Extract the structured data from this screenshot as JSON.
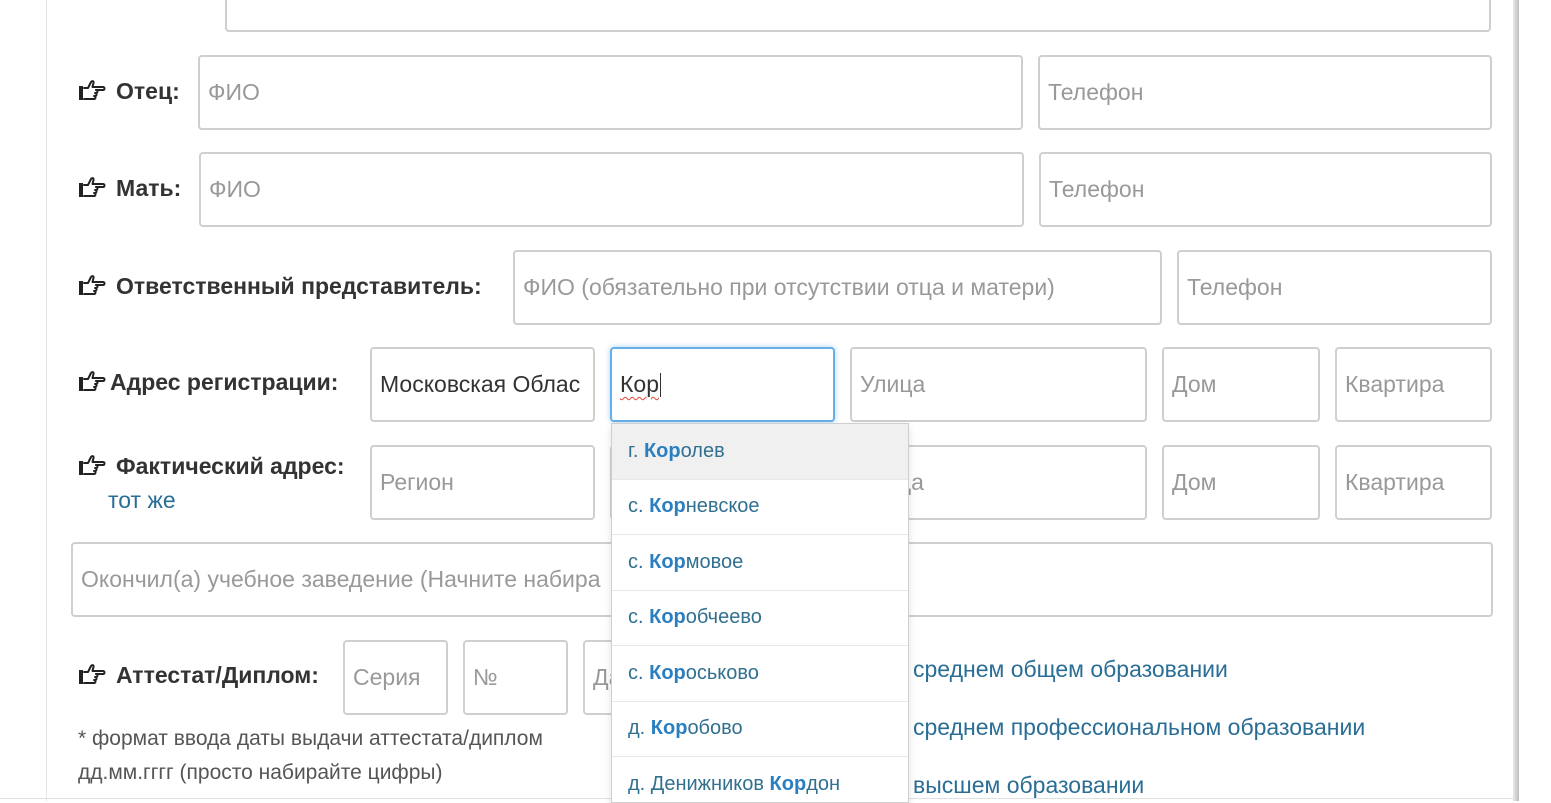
{
  "father": {
    "label": "Отец:",
    "fio_placeholder": "ФИО",
    "phone_placeholder": "Телефон"
  },
  "mother": {
    "label": "Мать:",
    "fio_placeholder": "ФИО",
    "phone_placeholder": "Телефон"
  },
  "guardian": {
    "label": "Ответственный представитель:",
    "fio_placeholder": "ФИО (обязательно при отсутствии отца и матери)",
    "phone_placeholder": "Телефон"
  },
  "reg_address": {
    "label": "Адрес регистрации:",
    "region_value": "Московская Облас",
    "city_value": "Кор",
    "street_placeholder": "Улица",
    "house_placeholder": "Дом",
    "apt_placeholder": "Квартира"
  },
  "fact_address": {
    "label": "Фактический адрес:",
    "same_link": "тот же",
    "region_placeholder": "Регион",
    "street_placeholder_visible": "ца",
    "house_placeholder": "Дом",
    "apt_placeholder": "Квартира"
  },
  "school": {
    "placeholder": "Окончил(а) учебное заведение (Начните набира"
  },
  "certificate": {
    "label": "Аттестат/Диплом:",
    "series_placeholder": "Серия",
    "number_placeholder": "№",
    "date_placeholder": "Да",
    "options": [
      "среднем общем образовании",
      "среднем профессиональном образовании",
      "высшем образовании"
    ],
    "note_line1": "* формат ввода даты выдачи аттестата/диплом",
    "note_line2": "дд.мм.гггг (просто набирайте цифры)"
  },
  "autocomplete": {
    "items": [
      {
        "prefix": "г. ",
        "match": "Кор",
        "rest": "олев"
      },
      {
        "prefix": "с. ",
        "match": "Кор",
        "rest": "невское"
      },
      {
        "prefix": "с. ",
        "match": "Кор",
        "rest": "мовое"
      },
      {
        "prefix": "с. ",
        "match": "Кор",
        "rest": "обчеево"
      },
      {
        "prefix": "с. ",
        "match": "Кор",
        "rest": "оськово"
      },
      {
        "prefix": "д. ",
        "match": "Кор",
        "rest": "обово"
      },
      {
        "prefix": "д. Денижников ",
        "match": "Кор",
        "rest": "дон"
      }
    ]
  },
  "icons": {
    "row_marker": "hand-pointing-right-icon"
  },
  "colors": {
    "link": "#2a6e96",
    "focus_border": "#66afe9",
    "match_highlight": "#2a7fc0"
  }
}
